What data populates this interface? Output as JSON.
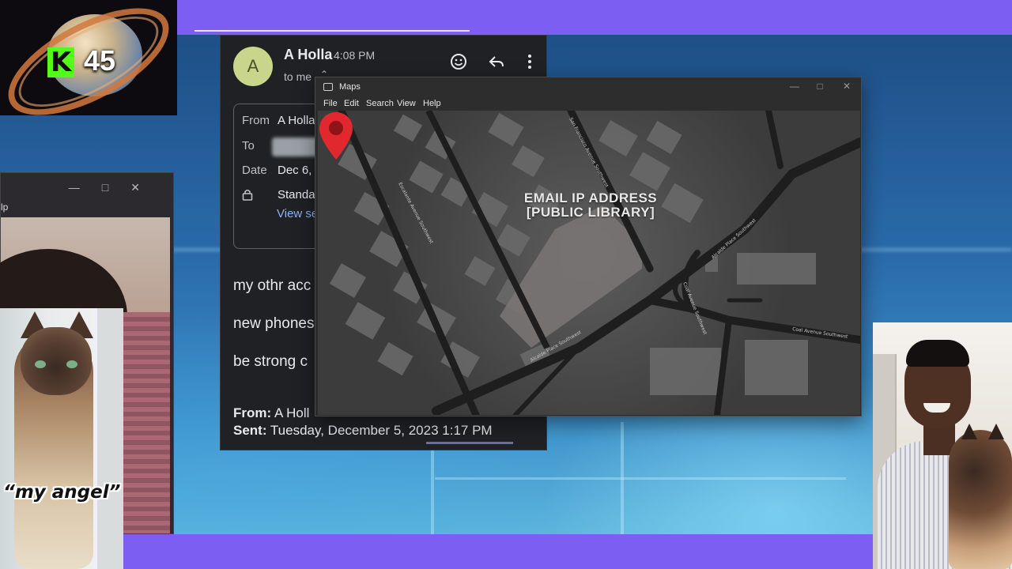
{
  "stream_overlay": {
    "kick_viewer_count": "45",
    "kick_logo_letter": "K",
    "cat_caption": "“my angel”",
    "accent_color": "#7c5ef2",
    "kick_brand_color": "#53fc18"
  },
  "left_window": {
    "menu_fragment": "lp",
    "controls": [
      "minimize",
      "maximize",
      "close"
    ]
  },
  "email": {
    "avatar_letter": "A",
    "sender_name": "A Holla",
    "sent_time": "4:08 PM",
    "to_me": "to me",
    "icons": [
      "emoji-icon",
      "reply-icon",
      "more-vert-icon"
    ],
    "details": {
      "from_label": "From",
      "from_value": "A Holla",
      "to_label": "To",
      "date_label": "Date",
      "date_value": "Dec 6,",
      "security_value": "Standa",
      "view_link": "View se"
    },
    "body_lines": [
      "my othr acc",
      "new phones",
      "be strong c"
    ],
    "footer": {
      "from_label": "From:",
      "from_value": "A Holl",
      "sent_label": "Sent:",
      "sent_value": "Tuesday, December 5, 2023 1:17 PM"
    }
  },
  "maps": {
    "title": "Maps",
    "menu": [
      "File",
      "Edit",
      "Search",
      "View",
      "Help"
    ],
    "annotation_line1": "EMAIL IP ADDRESS",
    "annotation_line2": "[PUBLIC LIBRARY]",
    "pin_color": "#e0282e",
    "streets": [
      "San Francisco Avenue Southwest",
      "Escalante Avenue Southwest",
      "Alcalde Place Southwest",
      "Coal Avenue Southwest",
      "Coal Avenue Southwest"
    ]
  }
}
